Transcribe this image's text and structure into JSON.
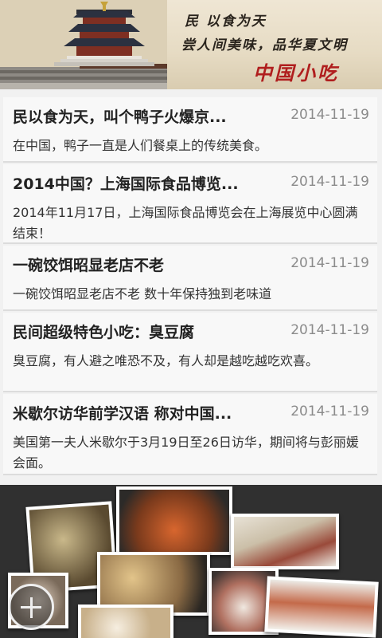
{
  "banner": {
    "motto_line1": "民  以食为天",
    "motto_line2": "尝人间美味，品华夏文明",
    "brand": "中国小吃"
  },
  "news": [
    {
      "title": "民以食为天，叫个鸭子火爆京...",
      "date": "2014-11-19",
      "summary": "在中国，鸭子一直是人们餐桌上的传统美食。"
    },
    {
      "title": "2014中国？上海国际食品博览...",
      "date": "2014-11-19",
      "summary": "2014年11月17日，上海国际食品博览会在上海展览中心圆满结束！"
    },
    {
      "title": "一碗饺饵昭显老店不老",
      "date": "2014-11-19",
      "summary": "一碗饺饵昭显老店不老 数十年保持独到老味道"
    },
    {
      "title": "民间超级特色小吃：臭豆腐",
      "date": "2014-11-19",
      "summary": "臭豆腐，有人避之唯恐不及，有人却是越吃越吃欢喜。"
    },
    {
      "title": "米歇尔访华前学汉语 称对中国...",
      "date": "2014-11-19",
      "summary": "美国第一夫人米歇尔于3月19日至26日访华，期间将与彭丽媛会面。"
    }
  ],
  "fab": {
    "icon": "plus-icon"
  },
  "colors": {
    "brand_red": "#b01e1e",
    "card_bg": "#f8f8f8",
    "date_gray": "#8b8b8b"
  }
}
